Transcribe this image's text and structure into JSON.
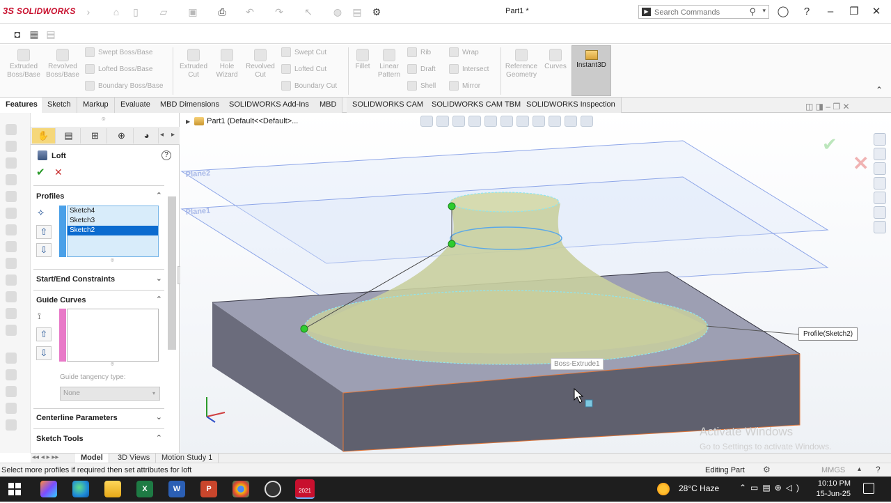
{
  "app": {
    "logo_text": "SOLIDWORKS",
    "logo_mark": "3S",
    "document_title": "Part1 *"
  },
  "search": {
    "placeholder": "Search Commands"
  },
  "command_manager": {
    "large": [
      {
        "label1": "Extruded",
        "label2": "Boss/Base"
      },
      {
        "label1": "Revolved",
        "label2": "Boss/Base"
      },
      {
        "label1": "Extruded",
        "label2": "Cut"
      },
      {
        "label1": "Hole",
        "label2": "Wizard"
      },
      {
        "label1": "Revolved",
        "label2": "Cut"
      },
      {
        "label1": "Fillet",
        "label2": ""
      },
      {
        "label1": "Linear",
        "label2": "Pattern"
      },
      {
        "label1": "Reference",
        "label2": "Geometry"
      },
      {
        "label1": "Curves",
        "label2": ""
      }
    ],
    "small": [
      "Swept Boss/Base",
      "Lofted Boss/Base",
      "Boundary Boss/Base",
      "Swept Cut",
      "Lofted Cut",
      "Boundary Cut",
      "Rib",
      "Draft",
      "Shell",
      "Wrap",
      "Intersect",
      "Mirror"
    ],
    "instant3d": "Instant3D"
  },
  "tabs": [
    "Features",
    "Sketch",
    "Markup",
    "Evaluate",
    "MBD Dimensions",
    "SOLIDWORKS Add-Ins",
    "MBD",
    "SOLIDWORKS CAM",
    "SOLIDWORKS CAM TBM",
    "SOLIDWORKS Inspection"
  ],
  "property_manager": {
    "title": "Loft",
    "help": "?",
    "ok": "✔",
    "cancel": "✕",
    "profiles": {
      "title": "Profiles",
      "items": [
        "Sketch4",
        "Sketch3",
        "Sketch2"
      ],
      "selected": "Sketch2"
    },
    "start_end": "Start/End Constraints",
    "guide_curves": "Guide Curves",
    "guide_tangency_label": "Guide tangency type:",
    "guide_tangency_value": "None",
    "centerline": "Centerline Parameters",
    "sketch_tools": "Sketch Tools"
  },
  "viewport": {
    "tree_label": "Part1",
    "tree_suffix": "(Default<<Default>...",
    "plane2": "Plane2",
    "plane1": "Plane1",
    "profile_callout": "Profile(Sketch2)",
    "extrude_callout": "Boss-Extrude1",
    "watermark_title": "Activate Windows",
    "watermark_sub": "Go to Settings to activate Windows.",
    "colors": {
      "plane": "#8ea6e8",
      "loft": "#c9cf9e",
      "block_top": "#9d9fb3",
      "block_side": "#5f606e",
      "point": "#2ecc2e"
    }
  },
  "bottom_tabs": [
    "Model",
    "3D Views",
    "Motion Study 1"
  ],
  "status": {
    "message": "Select more profiles if required then set attributes for loft",
    "mode": "Editing Part",
    "units": "MMGS"
  },
  "taskbar": {
    "weather": "28°C  Haze",
    "time": "10:10 PM",
    "date": "15-Jun-25",
    "sw_badge": "2021"
  }
}
